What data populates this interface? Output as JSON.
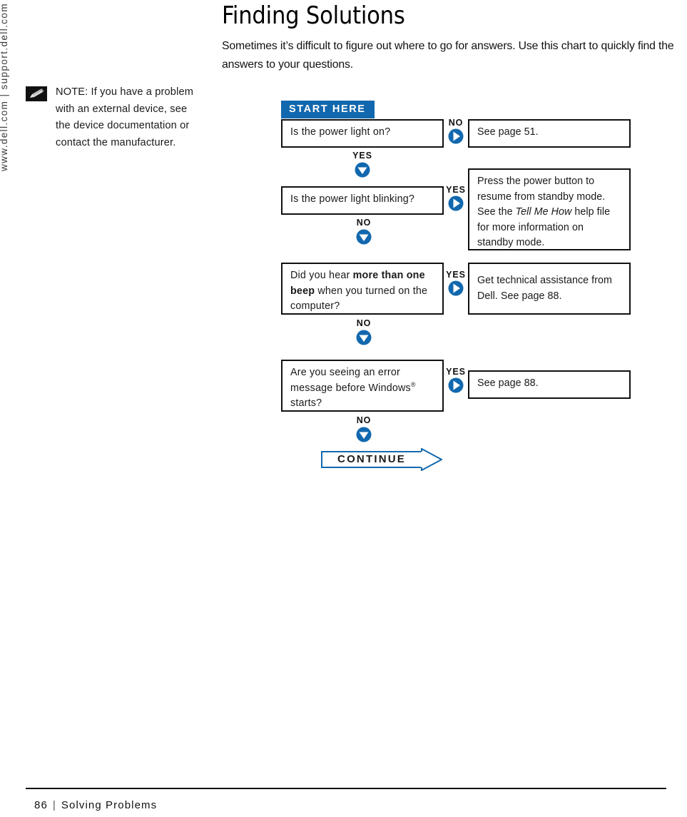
{
  "running_head": "www.dell.com | support.dell.com",
  "note": {
    "icon": "pencil-note-icon",
    "label": "NOTE:",
    "text": "NOTE: If you have a problem with an external device, see the device documentation or contact the manufacturer."
  },
  "header": {
    "title": "Finding Solutions",
    "intro": "Sometimes it’s difficult to figure out where to go for answers. Use this chart to quickly find the answers to your questions."
  },
  "flowchart": {
    "start_banner": "START HERE",
    "continue_banner": "CONTINUE",
    "accent_color": "#1268ae",
    "steps": [
      {
        "question": "Is the power light on?",
        "branch_right_label": "NO",
        "answer": "See page 51.",
        "branch_down_label": "YES"
      },
      {
        "question": "Is the power light blinking?",
        "branch_right_label": "YES",
        "answer": "Press the power button to resume from standby mode. See the Tell Me How help file for more information on standby mode.",
        "answer_italic_phrase": "Tell Me How",
        "branch_down_label": "NO"
      },
      {
        "question": "Did you hear more than one beep when you turned on the computer?",
        "question_bold_phrase": "more than one beep",
        "branch_right_label": "YES",
        "answer": "Get technical assistance from Dell. See page 88.",
        "branch_down_label": "NO"
      },
      {
        "question": "Are you seeing an error message before Windows® starts?",
        "branch_right_label": "YES",
        "answer": "See page 88.",
        "branch_down_label": "NO"
      }
    ]
  },
  "footer": {
    "page_number": "86",
    "separator": "|",
    "section": "Solving Problems"
  }
}
